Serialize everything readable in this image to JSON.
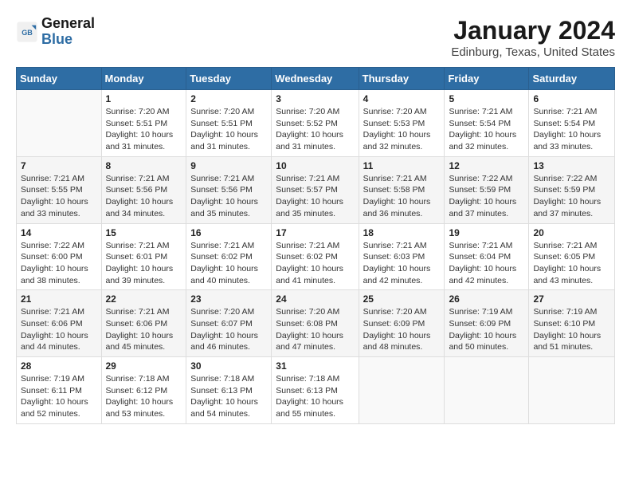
{
  "header": {
    "logo_line1": "General",
    "logo_line2": "Blue",
    "title": "January 2024",
    "subtitle": "Edinburg, Texas, United States"
  },
  "weekdays": [
    "Sunday",
    "Monday",
    "Tuesday",
    "Wednesday",
    "Thursday",
    "Friday",
    "Saturday"
  ],
  "weeks": [
    [
      {
        "day": "",
        "info": ""
      },
      {
        "day": "1",
        "info": "Sunrise: 7:20 AM\nSunset: 5:51 PM\nDaylight: 10 hours\nand 31 minutes."
      },
      {
        "day": "2",
        "info": "Sunrise: 7:20 AM\nSunset: 5:51 PM\nDaylight: 10 hours\nand 31 minutes."
      },
      {
        "day": "3",
        "info": "Sunrise: 7:20 AM\nSunset: 5:52 PM\nDaylight: 10 hours\nand 31 minutes."
      },
      {
        "day": "4",
        "info": "Sunrise: 7:20 AM\nSunset: 5:53 PM\nDaylight: 10 hours\nand 32 minutes."
      },
      {
        "day": "5",
        "info": "Sunrise: 7:21 AM\nSunset: 5:54 PM\nDaylight: 10 hours\nand 32 minutes."
      },
      {
        "day": "6",
        "info": "Sunrise: 7:21 AM\nSunset: 5:54 PM\nDaylight: 10 hours\nand 33 minutes."
      }
    ],
    [
      {
        "day": "7",
        "info": "Sunrise: 7:21 AM\nSunset: 5:55 PM\nDaylight: 10 hours\nand 33 minutes."
      },
      {
        "day": "8",
        "info": "Sunrise: 7:21 AM\nSunset: 5:56 PM\nDaylight: 10 hours\nand 34 minutes."
      },
      {
        "day": "9",
        "info": "Sunrise: 7:21 AM\nSunset: 5:56 PM\nDaylight: 10 hours\nand 35 minutes."
      },
      {
        "day": "10",
        "info": "Sunrise: 7:21 AM\nSunset: 5:57 PM\nDaylight: 10 hours\nand 35 minutes."
      },
      {
        "day": "11",
        "info": "Sunrise: 7:21 AM\nSunset: 5:58 PM\nDaylight: 10 hours\nand 36 minutes."
      },
      {
        "day": "12",
        "info": "Sunrise: 7:22 AM\nSunset: 5:59 PM\nDaylight: 10 hours\nand 37 minutes."
      },
      {
        "day": "13",
        "info": "Sunrise: 7:22 AM\nSunset: 5:59 PM\nDaylight: 10 hours\nand 37 minutes."
      }
    ],
    [
      {
        "day": "14",
        "info": "Sunrise: 7:22 AM\nSunset: 6:00 PM\nDaylight: 10 hours\nand 38 minutes."
      },
      {
        "day": "15",
        "info": "Sunrise: 7:21 AM\nSunset: 6:01 PM\nDaylight: 10 hours\nand 39 minutes."
      },
      {
        "day": "16",
        "info": "Sunrise: 7:21 AM\nSunset: 6:02 PM\nDaylight: 10 hours\nand 40 minutes."
      },
      {
        "day": "17",
        "info": "Sunrise: 7:21 AM\nSunset: 6:02 PM\nDaylight: 10 hours\nand 41 minutes."
      },
      {
        "day": "18",
        "info": "Sunrise: 7:21 AM\nSunset: 6:03 PM\nDaylight: 10 hours\nand 42 minutes."
      },
      {
        "day": "19",
        "info": "Sunrise: 7:21 AM\nSunset: 6:04 PM\nDaylight: 10 hours\nand 42 minutes."
      },
      {
        "day": "20",
        "info": "Sunrise: 7:21 AM\nSunset: 6:05 PM\nDaylight: 10 hours\nand 43 minutes."
      }
    ],
    [
      {
        "day": "21",
        "info": "Sunrise: 7:21 AM\nSunset: 6:06 PM\nDaylight: 10 hours\nand 44 minutes."
      },
      {
        "day": "22",
        "info": "Sunrise: 7:21 AM\nSunset: 6:06 PM\nDaylight: 10 hours\nand 45 minutes."
      },
      {
        "day": "23",
        "info": "Sunrise: 7:20 AM\nSunset: 6:07 PM\nDaylight: 10 hours\nand 46 minutes."
      },
      {
        "day": "24",
        "info": "Sunrise: 7:20 AM\nSunset: 6:08 PM\nDaylight: 10 hours\nand 47 minutes."
      },
      {
        "day": "25",
        "info": "Sunrise: 7:20 AM\nSunset: 6:09 PM\nDaylight: 10 hours\nand 48 minutes."
      },
      {
        "day": "26",
        "info": "Sunrise: 7:19 AM\nSunset: 6:09 PM\nDaylight: 10 hours\nand 50 minutes."
      },
      {
        "day": "27",
        "info": "Sunrise: 7:19 AM\nSunset: 6:10 PM\nDaylight: 10 hours\nand 51 minutes."
      }
    ],
    [
      {
        "day": "28",
        "info": "Sunrise: 7:19 AM\nSunset: 6:11 PM\nDaylight: 10 hours\nand 52 minutes."
      },
      {
        "day": "29",
        "info": "Sunrise: 7:18 AM\nSunset: 6:12 PM\nDaylight: 10 hours\nand 53 minutes."
      },
      {
        "day": "30",
        "info": "Sunrise: 7:18 AM\nSunset: 6:13 PM\nDaylight: 10 hours\nand 54 minutes."
      },
      {
        "day": "31",
        "info": "Sunrise: 7:18 AM\nSunset: 6:13 PM\nDaylight: 10 hours\nand 55 minutes."
      },
      {
        "day": "",
        "info": ""
      },
      {
        "day": "",
        "info": ""
      },
      {
        "day": "",
        "info": ""
      }
    ]
  ]
}
